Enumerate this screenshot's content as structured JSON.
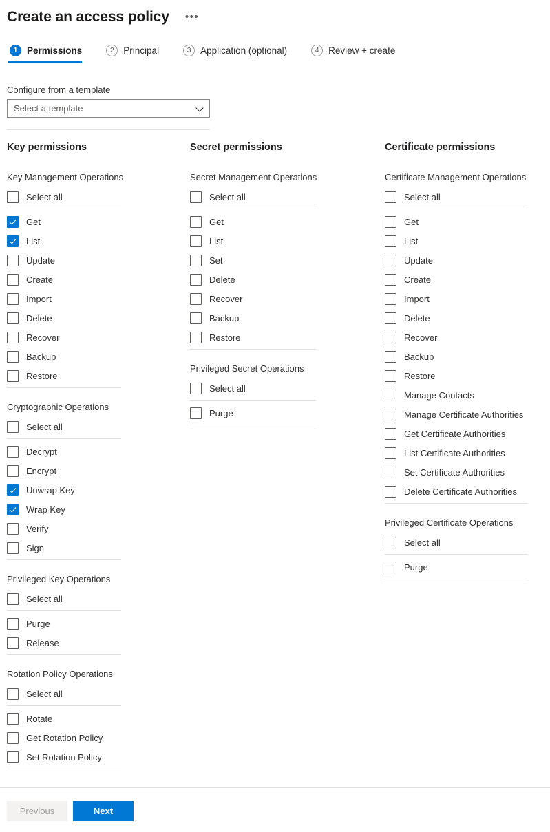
{
  "header": {
    "title": "Create an access policy",
    "more_label": "•••"
  },
  "wizard": {
    "tabs": [
      {
        "num": "1",
        "label": "Permissions",
        "active": true
      },
      {
        "num": "2",
        "label": "Principal",
        "active": false
      },
      {
        "num": "3",
        "label": "Application (optional)",
        "active": false
      },
      {
        "num": "4",
        "label": "Review + create",
        "active": false
      }
    ]
  },
  "template": {
    "label": "Configure from a template",
    "placeholder": "Select a template",
    "value": ""
  },
  "columns": [
    {
      "title": "Key permissions",
      "groups": [
        {
          "title": "Key Management Operations",
          "select_all": {
            "label": "Select all",
            "checked": false
          },
          "items": [
            {
              "label": "Get",
              "checked": true
            },
            {
              "label": "List",
              "checked": true
            },
            {
              "label": "Update",
              "checked": false
            },
            {
              "label": "Create",
              "checked": false
            },
            {
              "label": "Import",
              "checked": false
            },
            {
              "label": "Delete",
              "checked": false
            },
            {
              "label": "Recover",
              "checked": false
            },
            {
              "label": "Backup",
              "checked": false
            },
            {
              "label": "Restore",
              "checked": false
            }
          ]
        },
        {
          "title": "Cryptographic Operations",
          "select_all": {
            "label": "Select all",
            "checked": false
          },
          "items": [
            {
              "label": "Decrypt",
              "checked": false
            },
            {
              "label": "Encrypt",
              "checked": false
            },
            {
              "label": "Unwrap Key",
              "checked": true
            },
            {
              "label": "Wrap Key",
              "checked": true
            },
            {
              "label": "Verify",
              "checked": false
            },
            {
              "label": "Sign",
              "checked": false
            }
          ]
        },
        {
          "title": "Privileged Key Operations",
          "select_all": {
            "label": "Select all",
            "checked": false
          },
          "items": [
            {
              "label": "Purge",
              "checked": false
            },
            {
              "label": "Release",
              "checked": false
            }
          ]
        },
        {
          "title": "Rotation Policy Operations",
          "select_all": {
            "label": "Select all",
            "checked": false
          },
          "items": [
            {
              "label": "Rotate",
              "checked": false
            },
            {
              "label": "Get Rotation Policy",
              "checked": false
            },
            {
              "label": "Set Rotation Policy",
              "checked": false
            }
          ]
        }
      ]
    },
    {
      "title": "Secret permissions",
      "groups": [
        {
          "title": "Secret Management Operations",
          "select_all": {
            "label": "Select all",
            "checked": false
          },
          "items": [
            {
              "label": "Get",
              "checked": false
            },
            {
              "label": "List",
              "checked": false
            },
            {
              "label": "Set",
              "checked": false
            },
            {
              "label": "Delete",
              "checked": false
            },
            {
              "label": "Recover",
              "checked": false
            },
            {
              "label": "Backup",
              "checked": false
            },
            {
              "label": "Restore",
              "checked": false
            }
          ]
        },
        {
          "title": "Privileged Secret Operations",
          "select_all": {
            "label": "Select all",
            "checked": false
          },
          "items": [
            {
              "label": "Purge",
              "checked": false
            }
          ]
        }
      ]
    },
    {
      "title": "Certificate permissions",
      "groups": [
        {
          "title": "Certificate Management Operations",
          "select_all": {
            "label": "Select all",
            "checked": false
          },
          "items": [
            {
              "label": "Get",
              "checked": false
            },
            {
              "label": "List",
              "checked": false
            },
            {
              "label": "Update",
              "checked": false
            },
            {
              "label": "Create",
              "checked": false
            },
            {
              "label": "Import",
              "checked": false
            },
            {
              "label": "Delete",
              "checked": false
            },
            {
              "label": "Recover",
              "checked": false
            },
            {
              "label": "Backup",
              "checked": false
            },
            {
              "label": "Restore",
              "checked": false
            },
            {
              "label": "Manage Contacts",
              "checked": false
            },
            {
              "label": "Manage Certificate Authorities",
              "checked": false
            },
            {
              "label": "Get Certificate Authorities",
              "checked": false
            },
            {
              "label": "List Certificate Authorities",
              "checked": false
            },
            {
              "label": "Set Certificate Authorities",
              "checked": false
            },
            {
              "label": "Delete Certificate Authorities",
              "checked": false
            }
          ]
        },
        {
          "title": "Privileged Certificate Operations",
          "select_all": {
            "label": "Select all",
            "checked": false
          },
          "items": [
            {
              "label": "Purge",
              "checked": false
            }
          ]
        }
      ]
    }
  ],
  "footer": {
    "previous_label": "Previous",
    "next_label": "Next"
  },
  "colors": {
    "accent": "#0078d4",
    "text": "#323130",
    "divider": "#e1dfdd",
    "disabled_bg": "#f3f2f1",
    "disabled_text": "#a19f9d"
  }
}
